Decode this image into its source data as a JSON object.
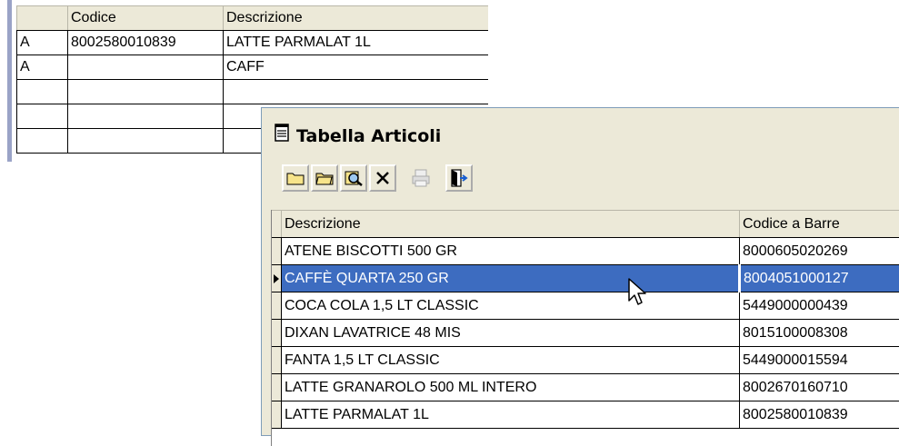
{
  "background_grid": {
    "headers": [
      "",
      "Codice",
      "Descrizione"
    ],
    "rows": [
      [
        "A",
        "8002580010839",
        "LATTE PARMALAT 1L"
      ],
      [
        "A",
        "",
        "CAFF"
      ],
      [
        "",
        "",
        ""
      ],
      [
        "",
        "",
        ""
      ],
      [
        "",
        "",
        ""
      ]
    ]
  },
  "dialog": {
    "title": "Tabella Articoli",
    "toolbar": {
      "buttons": [
        "open-folder-icon",
        "folder-icon",
        "search-icon",
        "delete-icon",
        "print-icon",
        "exit-icon"
      ]
    },
    "grid": {
      "headers": [
        "Descrizione",
        "Codice a Barre"
      ],
      "selected_row": 1,
      "rows": [
        [
          "ATENE BISCOTTI 500 GR",
          "8000605020269"
        ],
        [
          "CAFFÈ QUARTA 250 GR",
          "8004051000127"
        ],
        [
          "COCA COLA 1,5 LT CLASSIC",
          "5449000000439"
        ],
        [
          "DIXAN LAVATRICE 48 MIS",
          "8015100008308"
        ],
        [
          "FANTA 1,5 LT CLASSIC",
          "5449000015594"
        ],
        [
          "LATTE GRANAROLO 500 ML INTERO",
          "8002670160710"
        ],
        [
          "LATTE PARMALAT 1L",
          "8002580010839"
        ]
      ]
    }
  },
  "colors": {
    "selection": "#3d6cc0",
    "window_bg": "#ece9d8"
  }
}
